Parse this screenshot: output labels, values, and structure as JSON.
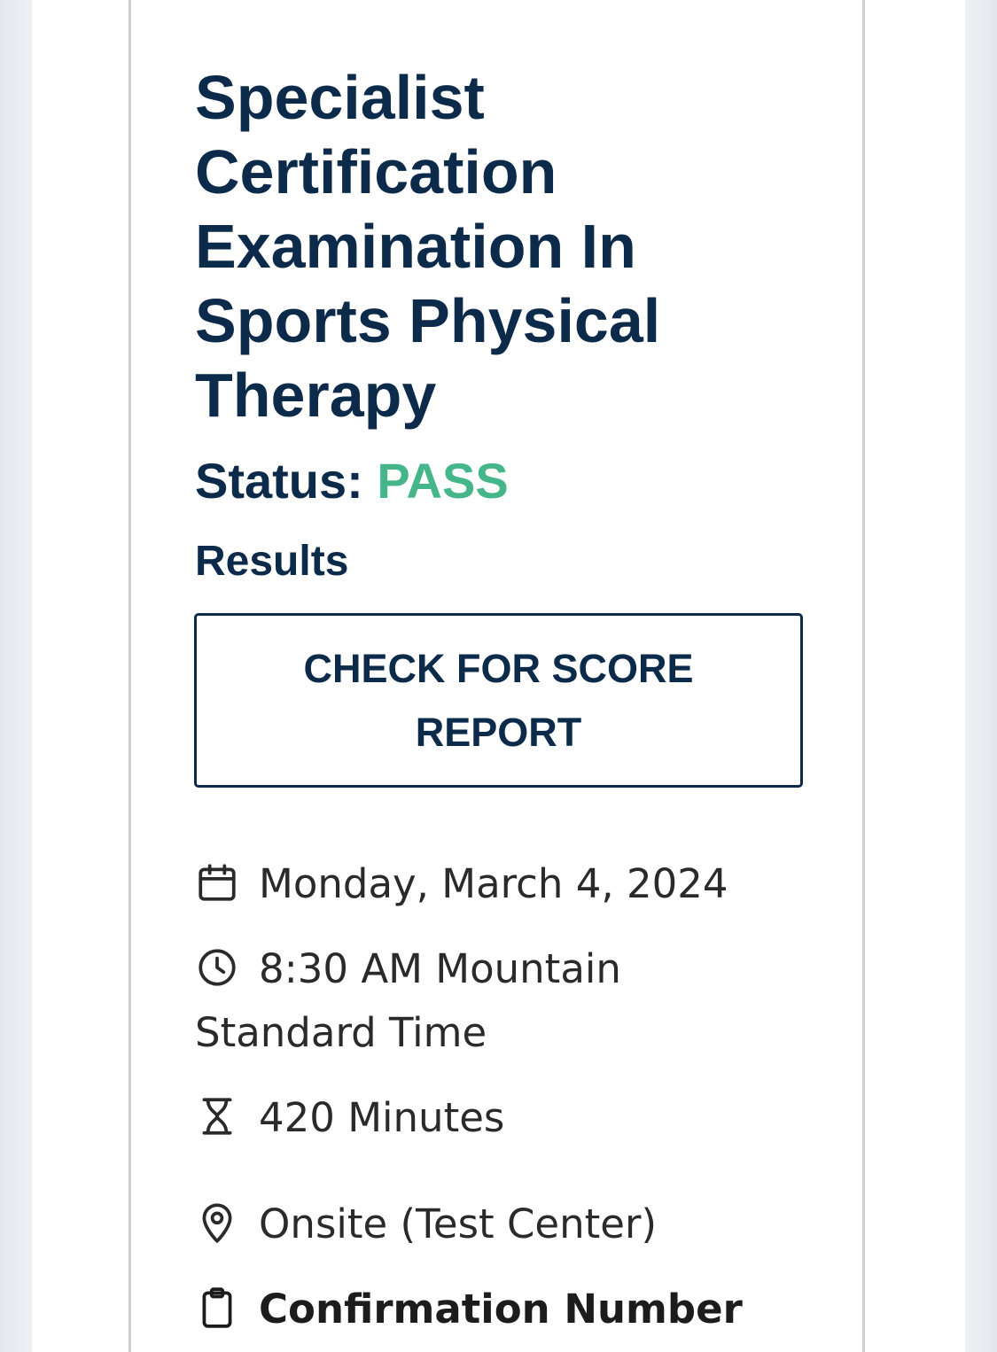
{
  "exam": {
    "title": "Specialist Certification Examination In Sports Physical Therapy",
    "status_label": "Status:",
    "status_value": "PASS",
    "results_label": "Results",
    "score_button_label": "CHECK FOR SCORE REPORT",
    "date": "Monday, March 4, 2024",
    "time": "8:30 AM Mountain Standard Time",
    "duration": "420 Minutes",
    "location": "Onsite (Test Center)",
    "confirmation_label": "Confirmation Number"
  },
  "icons": {
    "date": "calendar-icon",
    "time": "clock-icon",
    "duration": "hourglass-icon",
    "location": "map-pin-icon",
    "confirmation": "clipboard-icon"
  },
  "colors": {
    "heading": "#0c2a4a",
    "pass": "#45b68a",
    "body_text": "#2a2a2a"
  }
}
